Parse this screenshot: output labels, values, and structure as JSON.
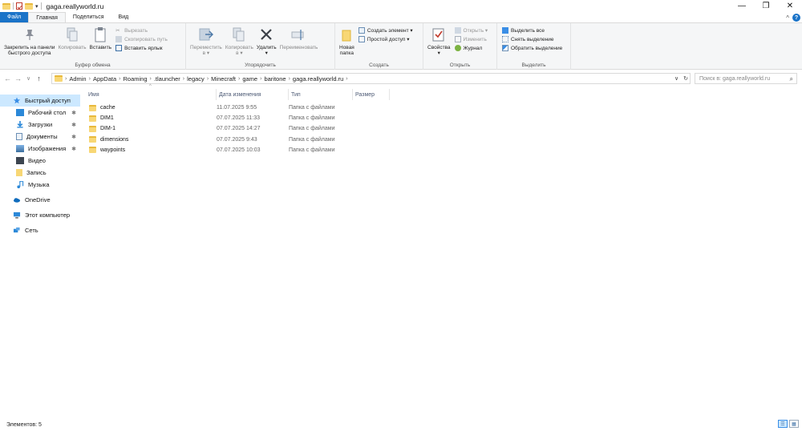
{
  "window": {
    "title": "gaga.reallyworld.ru",
    "minimize": "—",
    "maximize": "❐",
    "close": "✕",
    "quick_access_dropdown": "▾"
  },
  "ribbon_tabs": {
    "file": "Файл",
    "home": "Главная",
    "share": "Поделиться",
    "view": "Вид",
    "collapse_glyph": "^",
    "help_glyph": "?"
  },
  "ribbon": {
    "clipboard": {
      "label": "Буфер обмена",
      "pin": "Закрепить на панели\nбыстрого доступа",
      "copy": "Копировать",
      "paste": "Вставить",
      "cut": "Вырезать",
      "copy_path": "Скопировать путь",
      "paste_shortcut": "Вставить ярлык"
    },
    "organize": {
      "label": "Упорядочить",
      "move_to": "Переместить\nв ▾",
      "copy_to": "Копировать\nв ▾",
      "delete": "Удалить\n▾",
      "rename": "Переименовать"
    },
    "create": {
      "label": "Создать",
      "new_folder": "Новая\nпапка",
      "new_item": "Создать элемент ▾",
      "easy_access": "Простой доступ ▾"
    },
    "open": {
      "label": "Открыть",
      "properties": "Свойства\n▾",
      "open": "Открыть ▾",
      "edit": "Изменить",
      "history": "Журнал"
    },
    "select": {
      "label": "Выделить",
      "select_all": "Выделить все",
      "select_none": "Снять выделение",
      "invert": "Обратить выделение"
    }
  },
  "address": {
    "crumbs": [
      "Admin",
      "AppData",
      "Roaming",
      ".tlauncher",
      "legacy",
      "Minecraft",
      "game",
      "baritone",
      "gaga.reallyworld.ru"
    ],
    "dropdown": "∨",
    "refresh": "↻",
    "search_placeholder": "Поиск в: gaga.reallyworld.ru"
  },
  "nav": {
    "back": "←",
    "forward": "→",
    "recent": "∨",
    "up": "↑"
  },
  "navpane": [
    {
      "label": "Быстрый доступ",
      "icon": "star-icon",
      "selected": true,
      "pinned": false,
      "level": 1
    },
    {
      "label": "Рабочий стол",
      "icon": "desktop-icon",
      "pinned": true,
      "level": 2
    },
    {
      "label": "Загрузки",
      "icon": "downloads-icon",
      "pinned": true,
      "level": 2
    },
    {
      "label": "Документы",
      "icon": "documents-icon",
      "pinned": true,
      "level": 2
    },
    {
      "label": "Изображения",
      "icon": "pictures-icon",
      "pinned": true,
      "level": 2
    },
    {
      "label": "Видео",
      "icon": "video-icon",
      "pinned": false,
      "level": 2
    },
    {
      "label": "Запись",
      "icon": "folder-icon",
      "pinned": false,
      "level": 2
    },
    {
      "label": "Музыка",
      "icon": "music-icon",
      "pinned": false,
      "level": 2
    },
    {
      "label": "OneDrive",
      "icon": "onedrive-icon",
      "pinned": false,
      "level": 1
    },
    {
      "label": "Этот компьютер",
      "icon": "computer-icon",
      "pinned": false,
      "level": 1
    },
    {
      "label": "Сеть",
      "icon": "network-icon",
      "pinned": false,
      "level": 1
    }
  ],
  "pin_glyph": "✱",
  "columns": {
    "name": "Имя",
    "date": "Дата изменения",
    "type": "Тип",
    "size": "Размер",
    "sort_glyph": "^"
  },
  "files": [
    {
      "name": "cache",
      "date": "11.07.2025 9:55",
      "type": "Папка с файлами"
    },
    {
      "name": "DIM1",
      "date": "07.07.2025 11:33",
      "type": "Папка с файлами"
    },
    {
      "name": "DIM-1",
      "date": "07.07.2025 14:27",
      "type": "Папка с файлами"
    },
    {
      "name": "dimensions",
      "date": "07.07.2025 9:43",
      "type": "Папка с файлами"
    },
    {
      "name": "waypoints",
      "date": "07.07.2025 10:03",
      "type": "Папка с файлами"
    }
  ],
  "status": {
    "items_count": "Элементов: 5"
  },
  "colors": {
    "accent": "#1a73c8",
    "selection": "#cce8ff",
    "folder": "#f8d775"
  }
}
